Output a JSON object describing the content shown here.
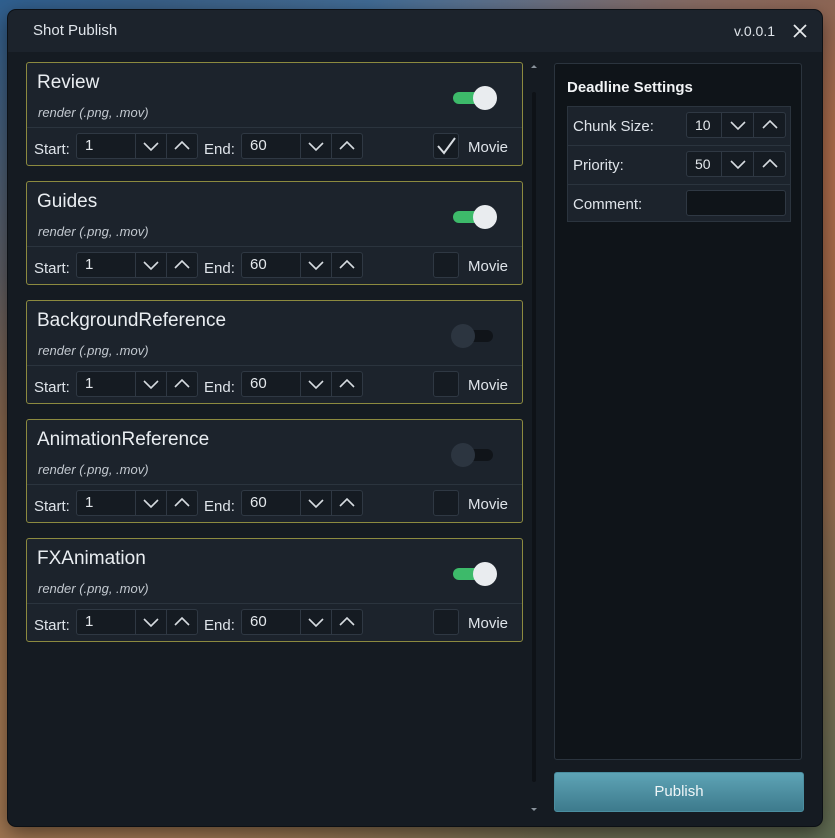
{
  "window": {
    "title": "Shot Publish",
    "version": "v.0.0.1"
  },
  "colors": {
    "accent_toggle_on": "#3dba6a",
    "card_border": "#8c8a3f",
    "publish_button": "#4a90a2"
  },
  "cards": [
    {
      "title": "Review",
      "subtitle": "render  (.png, .mov)",
      "enabled": true,
      "start_label": "Start:",
      "start": "1",
      "end_label": "End:",
      "end": "60",
      "movie_label": "Movie",
      "movie_checked": true
    },
    {
      "title": "Guides",
      "subtitle": "render  (.png, .mov)",
      "enabled": true,
      "start_label": "Start:",
      "start": "1",
      "end_label": "End:",
      "end": "60",
      "movie_label": "Movie",
      "movie_checked": false
    },
    {
      "title": "BackgroundReference",
      "subtitle": "render  (.png, .mov)",
      "enabled": false,
      "start_label": "Start:",
      "start": "1",
      "end_label": "End:",
      "end": "60",
      "movie_label": "Movie",
      "movie_checked": false
    },
    {
      "title": "AnimationReference",
      "subtitle": "render  (.png, .mov)",
      "enabled": false,
      "start_label": "Start:",
      "start": "1",
      "end_label": "End:",
      "end": "60",
      "movie_label": "Movie",
      "movie_checked": false
    },
    {
      "title": "FXAnimation",
      "subtitle": "render  (.png, .mov)",
      "enabled": true,
      "start_label": "Start:",
      "start": "1",
      "end_label": "End:",
      "end": "60",
      "movie_label": "Movie",
      "movie_checked": false
    }
  ],
  "deadline": {
    "title": "Deadline Settings",
    "chunk_size_label": "Chunk Size:",
    "chunk_size": "10",
    "priority_label": "Priority:",
    "priority": "50",
    "comment_label": "Comment:",
    "comment_value": ""
  },
  "publish_label": "Publish",
  "icons": {
    "close": "close-icon",
    "up": "chevron-up-icon",
    "down": "chevron-down-icon",
    "check": "checkmark-icon"
  }
}
